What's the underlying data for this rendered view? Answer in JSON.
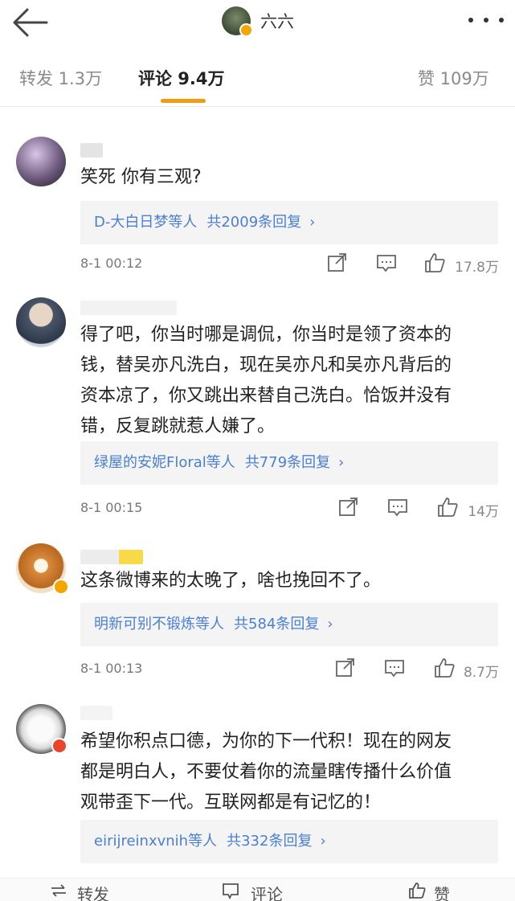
{
  "header": {
    "title": "六六",
    "back_icon": "arrow-left-icon",
    "more_icon": "more-dots-icon"
  },
  "tabs": {
    "repost": "转发 1.3万",
    "comments": "评论 9.4万",
    "likes": "赞 109万",
    "accent_color": "#f39c12"
  },
  "comments": [
    {
      "text": "笑死 你有三观?",
      "reply_names": "D-大白日梦等人",
      "reply_count": "共2009条回复",
      "time": "8-1 00:12",
      "likes": "17.8万"
    },
    {
      "text_lines": [
        "得了吧，你当时哪是调侃，你当时是领了资本的",
        "钱，替吴亦凡洗白，现在吴亦凡和吴亦凡背后的",
        "资本凉了，你又跳出来替自己洗白。恰饭并没有",
        "错，反复跳就惹人嫌了。"
      ],
      "reply_names": "绿屋的安妮Floral等人",
      "reply_count": "共779条回复",
      "time": "8-1 00:15",
      "likes": "14万"
    },
    {
      "text": "这条微博来的太晚了，啥也挽回不了。",
      "reply_names": "明新可别不锻炼等人",
      "reply_count": "共584条回复",
      "time": "8-1 00:13",
      "likes": "8.7万"
    },
    {
      "text_lines": [
        "希望你积点口德，为你的下一代积！现在的网友",
        "都是明白人，不要仗着你的流量瞎传播什么价值",
        "观带歪下一代。互联网都是有记忆的！"
      ],
      "reply_names": "eirijreinxvnih等人",
      "reply_count": "共332条回复"
    }
  ],
  "reply_chevron": "›",
  "bottom_bar": {
    "repost": "转发",
    "comment": "评论",
    "like": "赞"
  }
}
